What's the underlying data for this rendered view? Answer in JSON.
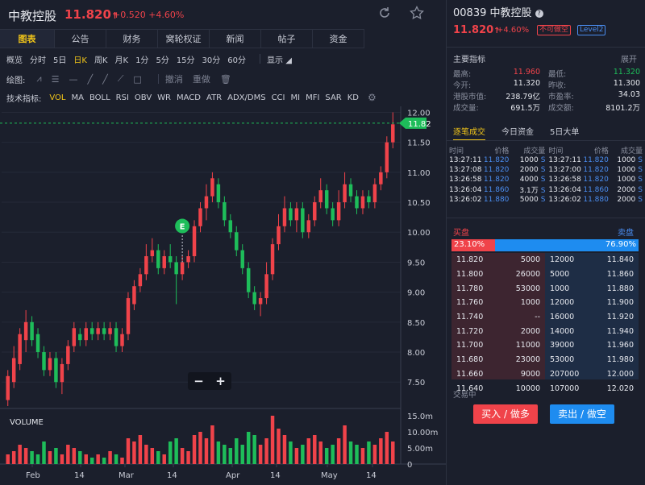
{
  "header": {
    "stock_name": "中教控股",
    "price": "11.820",
    "price_arrow": "↑",
    "change": "+0.520",
    "change_pct": "+4.60%",
    "refresh_icon": "refresh-icon",
    "star_icon": "star-icon"
  },
  "tabs": [
    "图表",
    "公告",
    "财务",
    "窝轮权证",
    "新闻",
    "帖子",
    "资金"
  ],
  "periods": [
    "概览",
    "分时",
    "5日",
    "日K",
    "周K",
    "月K",
    "1分",
    "5分",
    "15分",
    "30分",
    "60分"
  ],
  "display_label": "显示",
  "draw_label": "绘图:",
  "draw_undo": "撤消",
  "draw_redo": "重做",
  "indicators_label": "技术指标:",
  "indicators": [
    "VOL",
    "MA",
    "BOLL",
    "RSI",
    "OBV",
    "WR",
    "MACD",
    "ATR",
    "ADX/DMS",
    "CCI",
    "MI",
    "MFI",
    "SAR",
    "KD"
  ],
  "zoom": {
    "minus": "−",
    "plus": "+"
  },
  "event_marker": "E",
  "chart_data": {
    "type": "candlestick",
    "price_label": "11.82",
    "y_ticks": [
      "12.00",
      "11.50",
      "11.00",
      "10.50",
      "10.00",
      "9.50",
      "9.00",
      "8.50",
      "8.00",
      "7.50"
    ],
    "y_range": [
      7.1,
      12.1
    ],
    "x_ticks": [
      "Feb",
      "14",
      "Mar",
      "14",
      "Apr",
      "14",
      "May",
      "14"
    ],
    "volume_label": "VOLUME",
    "volume_ticks": [
      "15.0m",
      "10.00m",
      "5.00m",
      "0"
    ],
    "volume_range": [
      0,
      16
    ],
    "candles": [
      [
        7.2,
        7.6,
        7.1,
        7.7
      ],
      [
        7.5,
        7.9,
        7.4,
        8.1
      ],
      [
        7.8,
        8.3,
        7.7,
        8.4
      ],
      [
        8.2,
        8.5,
        8.0,
        8.7
      ],
      [
        8.5,
        8.2,
        8.1,
        8.6
      ],
      [
        8.3,
        8.0,
        7.9,
        8.4
      ],
      [
        8.0,
        7.7,
        7.6,
        8.1
      ],
      [
        7.7,
        7.9,
        7.6,
        8.0
      ],
      [
        7.9,
        7.5,
        7.4,
        8.0
      ],
      [
        7.5,
        7.8,
        7.3,
        7.9
      ],
      [
        7.8,
        8.1,
        7.7,
        8.2
      ],
      [
        8.1,
        8.4,
        8.0,
        8.5
      ],
      [
        8.3,
        8.2,
        8.1,
        8.4
      ],
      [
        8.2,
        8.4,
        8.1,
        8.5
      ],
      [
        8.4,
        8.3,
        8.2,
        8.5
      ],
      [
        8.3,
        8.4,
        8.2,
        8.5
      ],
      [
        8.4,
        8.3,
        8.2,
        8.5
      ],
      [
        8.3,
        8.4,
        8.2,
        8.5
      ],
      [
        8.4,
        8.1,
        8.0,
        8.5
      ],
      [
        8.1,
        8.3,
        8.0,
        8.4
      ],
      [
        8.3,
        8.9,
        8.2,
        9.0
      ],
      [
        8.8,
        9.1,
        8.7,
        9.2
      ],
      [
        9.1,
        9.3,
        9.0,
        9.4
      ],
      [
        9.3,
        9.6,
        9.2,
        9.8
      ],
      [
        9.6,
        9.7,
        9.5,
        9.9
      ],
      [
        9.7,
        9.4,
        9.3,
        9.8
      ],
      [
        9.4,
        9.6,
        9.3,
        9.7
      ],
      [
        9.6,
        9.5,
        9.4,
        9.8
      ],
      [
        9.5,
        9.3,
        8.8,
        9.6
      ],
      [
        9.3,
        9.5,
        9.2,
        9.6
      ],
      [
        9.5,
        9.6,
        9.4,
        9.7
      ],
      [
        9.6,
        10.1,
        9.5,
        10.2
      ],
      [
        10.1,
        10.4,
        10.0,
        10.5
      ],
      [
        10.4,
        10.6,
        10.2,
        10.8
      ],
      [
        10.6,
        10.9,
        10.5,
        11.0
      ],
      [
        10.8,
        10.5,
        10.4,
        10.9
      ],
      [
        10.5,
        10.2,
        10.1,
        10.6
      ],
      [
        10.2,
        10.0,
        9.9,
        10.3
      ],
      [
        10.0,
        9.7,
        9.6,
        10.1
      ],
      [
        9.7,
        9.4,
        9.3,
        9.8
      ],
      [
        9.4,
        9.0,
        8.9,
        9.5
      ],
      [
        9.0,
        8.8,
        8.7,
        9.1
      ],
      [
        8.8,
        8.9,
        8.6,
        9.0
      ],
      [
        8.9,
        9.3,
        8.8,
        9.5
      ],
      [
        9.3,
        9.8,
        9.2,
        9.9
      ],
      [
        9.8,
        10.1,
        9.7,
        10.3
      ],
      [
        10.1,
        10.4,
        10.0,
        10.6
      ],
      [
        10.4,
        10.2,
        10.1,
        10.5
      ],
      [
        10.2,
        10.4,
        10.0,
        10.5
      ],
      [
        10.4,
        10.0,
        9.9,
        10.5
      ],
      [
        10.0,
        10.2,
        9.9,
        10.3
      ],
      [
        10.2,
        10.5,
        10.1,
        10.6
      ],
      [
        10.5,
        10.7,
        10.4,
        10.9
      ],
      [
        10.7,
        10.4,
        10.3,
        10.8
      ],
      [
        10.4,
        10.2,
        10.1,
        10.5
      ],
      [
        10.2,
        10.5,
        10.1,
        10.7
      ],
      [
        10.5,
        10.8,
        10.4,
        11.0
      ],
      [
        10.8,
        10.6,
        10.5,
        10.9
      ],
      [
        10.6,
        10.4,
        10.3,
        10.7
      ],
      [
        10.4,
        10.6,
        10.3,
        10.7
      ],
      [
        10.6,
        10.5,
        10.4,
        10.7
      ],
      [
        10.5,
        10.8,
        10.4,
        10.9
      ],
      [
        10.8,
        11.0,
        10.7,
        11.1
      ],
      [
        11.0,
        11.5,
        10.9,
        11.6
      ],
      [
        11.5,
        11.8,
        11.4,
        12.0
      ]
    ],
    "volumes": [
      3,
      4,
      6,
      5,
      4,
      3,
      7,
      4,
      5,
      3,
      6,
      5,
      4,
      3,
      2,
      3,
      2,
      4,
      3,
      2,
      8,
      7,
      9,
      6,
      5,
      4,
      3,
      7,
      8,
      5,
      4,
      9,
      10,
      8,
      12,
      7,
      6,
      5,
      8,
      6,
      10,
      9,
      6,
      8,
      15,
      11,
      9,
      7,
      5,
      6,
      8,
      9,
      7,
      5,
      6,
      8,
      12,
      7,
      6,
      5,
      7,
      6,
      8,
      10,
      7
    ]
  },
  "right": {
    "code": "00839",
    "name": "中教控股",
    "info_icon": "info-icon",
    "price": "11.820",
    "price_arrow": "↑",
    "change_pct": "+4.60%",
    "badge_short": "不可做空",
    "badge_level": "Level2",
    "main_label": "主要指标",
    "expand_label": "展开",
    "stats": [
      {
        "k": "最高:",
        "v": "11.960",
        "k2": "最低:",
        "v2": "11.320"
      },
      {
        "k": "今开:",
        "v": "11.320",
        "k2": "昨收:",
        "v2": "11.300"
      },
      {
        "k": "港股市值:",
        "v": "238.79亿",
        "k2": "市盈率:",
        "v2": "34.03"
      },
      {
        "k": "成交量:",
        "v": "691.5万",
        "k2": "成交额:",
        "v2": "8101.2万"
      }
    ],
    "trade_tabs": [
      "逐笔成交",
      "今日资金",
      "5日大单"
    ],
    "tick_headers": [
      "时间",
      "价格",
      "成交量",
      "时间",
      "价格",
      "成交量"
    ],
    "ticks": [
      [
        "13:27:11",
        "11.820",
        "1000",
        "S",
        "13:27:11",
        "11.820",
        "1000",
        "S"
      ],
      [
        "13:27:08",
        "11.820",
        "2000",
        "S",
        "13:27:00",
        "11.820",
        "1000",
        "S"
      ],
      [
        "13:26:58",
        "11.820",
        "4000",
        "S",
        "13:26:58",
        "11.820",
        "1000",
        "S"
      ],
      [
        "13:26:04",
        "11.860",
        "3.1万",
        "S",
        "13:26:04",
        "11.860",
        "2000",
        "S"
      ],
      [
        "13:26:02",
        "11.880",
        "5000",
        "S",
        "13:26:02",
        "11.880",
        "2000",
        "S"
      ]
    ],
    "bid_label": "买盘",
    "ask_label": "卖盘",
    "bid_pct": "23.10%",
    "ask_pct": "76.90%",
    "bid_ratio": 0.231,
    "orderbook": [
      [
        "11.820",
        "5000",
        "12000",
        "11.840"
      ],
      [
        "11.800",
        "26000",
        "5000",
        "11.860"
      ],
      [
        "11.780",
        "53000",
        "1000",
        "11.880"
      ],
      [
        "11.760",
        "1000",
        "12000",
        "11.900"
      ],
      [
        "11.740",
        "--",
        "16000",
        "11.920"
      ],
      [
        "11.720",
        "2000",
        "14000",
        "11.940"
      ],
      [
        "11.700",
        "11000",
        "39000",
        "11.960"
      ],
      [
        "11.680",
        "23000",
        "53000",
        "11.980"
      ],
      [
        "11.660",
        "9000",
        "207000",
        "12.000"
      ],
      [
        "11.640",
        "10000",
        "107000",
        "12.020"
      ]
    ],
    "trading_status": "交易中",
    "buy_button": "买入 / 做多",
    "sell_button": "卖出 / 做空"
  },
  "colors": {
    "up": "#f0434a",
    "down": "#1ebd5a",
    "accent": "#f0c419",
    "blue": "#1e8cf0"
  }
}
